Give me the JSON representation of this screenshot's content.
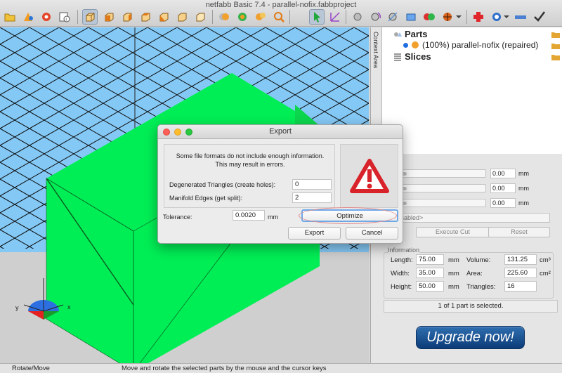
{
  "window": {
    "title": "netfabb Basic 7.4 - parallel-nofix.fabbproject"
  },
  "toolbar": {
    "buttons": [
      {
        "name": "open-icon"
      },
      {
        "name": "add-part-icon"
      },
      {
        "name": "repair-icon"
      },
      {
        "name": "info-icon"
      },
      {
        "name": "view-perspective-icon",
        "active": true
      },
      {
        "name": "view-front-icon"
      },
      {
        "name": "view-back-icon"
      },
      {
        "name": "view-left-icon"
      },
      {
        "name": "view-right-icon"
      },
      {
        "name": "view-top-icon"
      },
      {
        "name": "view-bottom-icon"
      },
      {
        "name": "shade-icon"
      },
      {
        "name": "color-icon"
      },
      {
        "name": "zoom-icon"
      },
      {
        "name": "select-icon",
        "active": true
      },
      {
        "name": "move-icon"
      },
      {
        "name": "sphere-icon"
      },
      {
        "name": "rotate-icon"
      },
      {
        "name": "scale-icon"
      },
      {
        "name": "mirror-icon"
      },
      {
        "name": "boolean-icon"
      },
      {
        "name": "ball-icon"
      },
      {
        "name": "repair-cross-icon"
      },
      {
        "name": "measure-icon"
      },
      {
        "name": "ruler-icon"
      },
      {
        "name": "check-icon"
      }
    ]
  },
  "tree": {
    "tab_label": "Context Area",
    "parts_label": "Parts",
    "part_item": "(100%) parallel-nofix (repaired)",
    "slices_label": "Slices"
  },
  "cut": {
    "rows": [
      {
        "value": "0.00",
        "unit": "mm"
      },
      {
        "value": "0.00",
        "unit": "mm"
      },
      {
        "value": "0.00",
        "unit": "mm"
      }
    ],
    "select_text": "tting disabled>",
    "execute_label": "Execute Cut",
    "reset_label": "Reset"
  },
  "info": {
    "title": "Information",
    "length_label": "Length:",
    "length_value": "75.00",
    "length_unit": "mm",
    "width_label": "Width:",
    "width_value": "35.00",
    "width_unit": "mm",
    "height_label": "Height:",
    "height_value": "50.00",
    "height_unit": "mm",
    "volume_label": "Volume:",
    "volume_value": "131.25",
    "volume_unit": "cm³",
    "area_label": "Area:",
    "area_value": "225.60",
    "area_unit": "cm²",
    "triangles_label": "Triangles:",
    "triangles_value": "16",
    "selected_status": "1 of 1 part is selected."
  },
  "upgrade": {
    "label": "Upgrade now!"
  },
  "statusbar": {
    "mode": "Rotate/Move",
    "message": "Move and rotate the selected parts by the mouse and the cursor keys"
  },
  "axes": {
    "x": "x",
    "y": "y"
  },
  "dialog": {
    "title": "Export",
    "message": "Some file formats do not include enough information. This may result in errors.",
    "degenerated_label": "Degenerated Triangles (create holes):",
    "degenerated_value": "0",
    "manifold_label": "Manifold Edges (get split):",
    "manifold_value": "2",
    "tolerance_label": "Tolerance:",
    "tolerance_value": "0.0020",
    "tolerance_unit": "mm",
    "optimize_label": "Optimize",
    "export_label": "Export",
    "cancel_label": "Cancel"
  },
  "colors": {
    "part_green": "#00ee55",
    "sky": "#84c8f5",
    "upgrade_blue": "#0c3b78",
    "accent_orange": "#e07a18",
    "warning_red": "#d8232a"
  }
}
